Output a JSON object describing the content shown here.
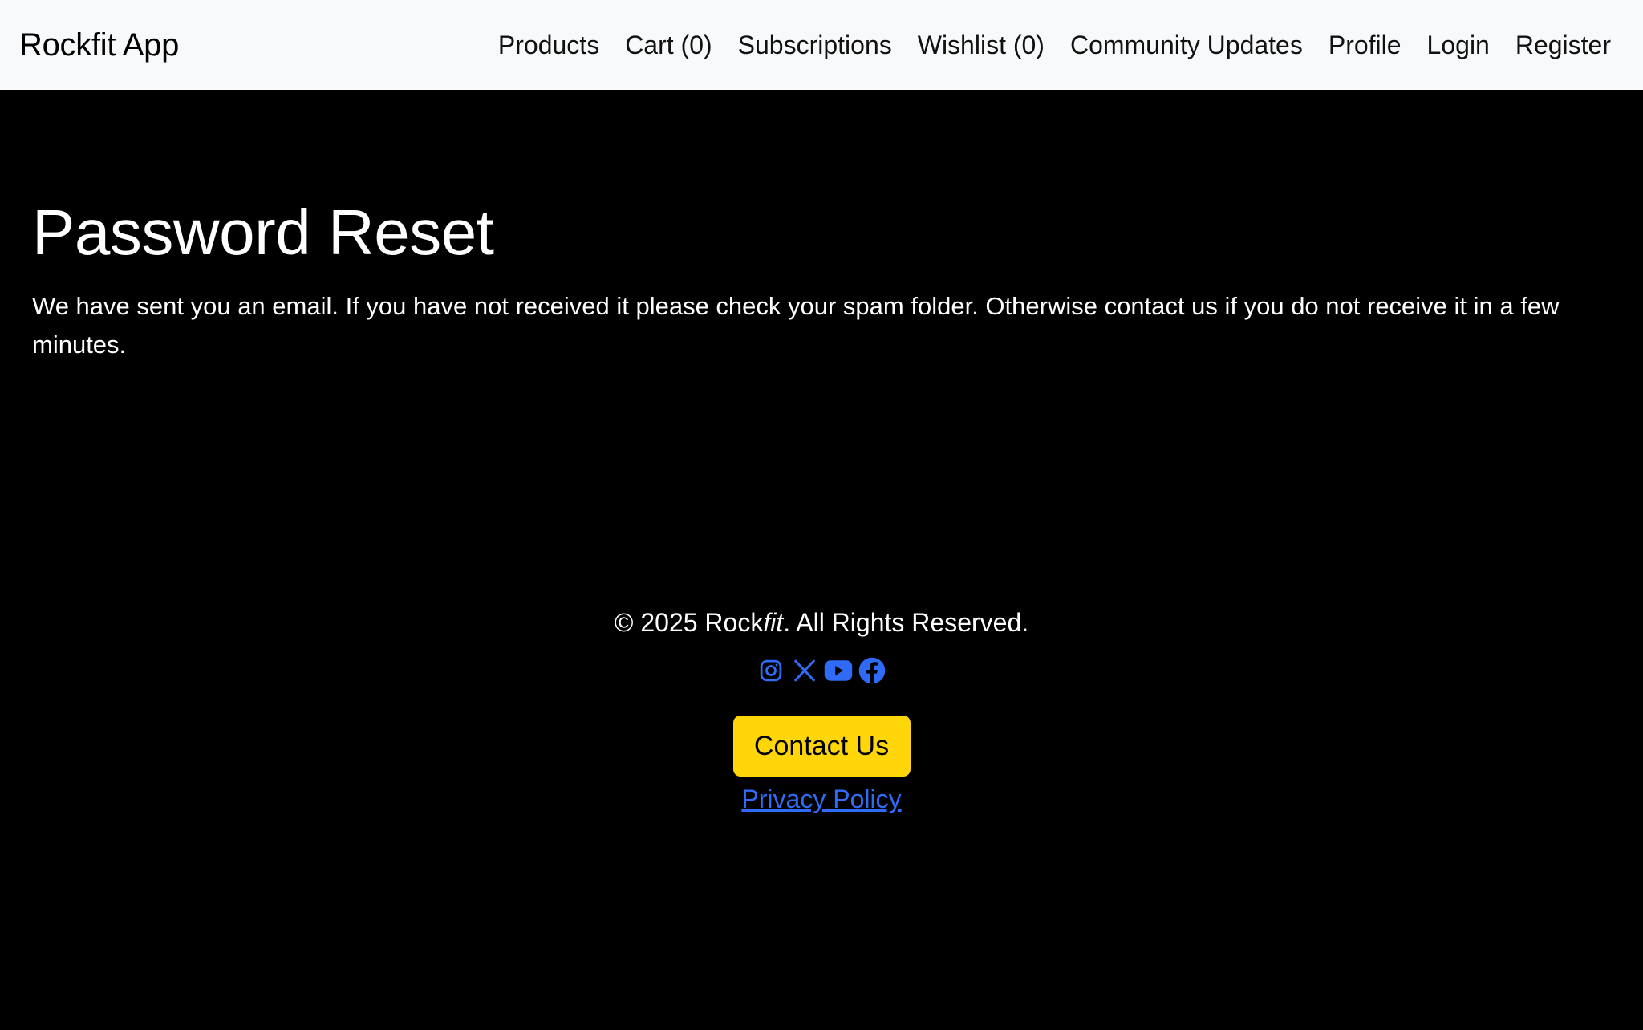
{
  "navbar": {
    "brand": "Rockfit App",
    "links": [
      {
        "id": "products",
        "label": "Products"
      },
      {
        "id": "cart",
        "label": "Cart (0)"
      },
      {
        "id": "subscriptions",
        "label": "Subscriptions"
      },
      {
        "id": "wishlist",
        "label": "Wishlist (0)"
      },
      {
        "id": "community-updates",
        "label": "Community Updates"
      },
      {
        "id": "profile",
        "label": "Profile"
      },
      {
        "id": "login",
        "label": "Login"
      },
      {
        "id": "register",
        "label": "Register"
      }
    ]
  },
  "main": {
    "title": "Password Reset",
    "message": "We have sent you an email. If you have not received it please check your spam folder. Otherwise contact us if you do not receive it in a few minutes."
  },
  "footer": {
    "copyright_prefix": "© 2025 Rock",
    "copyright_italic": "fit",
    "copyright_suffix": ". All Rights Reserved.",
    "social_icons": [
      "instagram-icon",
      "x-icon",
      "youtube-icon",
      "facebook-icon"
    ],
    "contact_label": "Contact Us",
    "privacy_label": "Privacy Policy"
  },
  "colors": {
    "background": "#000000",
    "navbar_bg": "#f8f9fa",
    "accent_yellow": "#ffd60a",
    "link_blue": "#2f6bf6"
  }
}
